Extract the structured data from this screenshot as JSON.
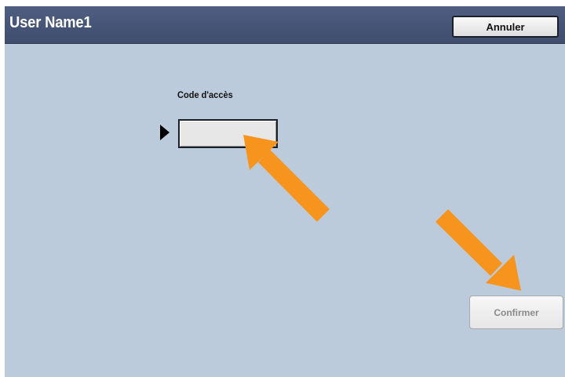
{
  "header": {
    "title": "User Name1",
    "cancel_label": "Annuler"
  },
  "form": {
    "passcode_label": "Code d'accès",
    "passcode_value": ""
  },
  "actions": {
    "confirm_label": "Confirmer",
    "confirm_enabled": false
  },
  "annotations": {
    "arrow_color": "#f7941d"
  },
  "colors": {
    "screen_background": "#bccbdb",
    "titlebar": "#46557a"
  }
}
